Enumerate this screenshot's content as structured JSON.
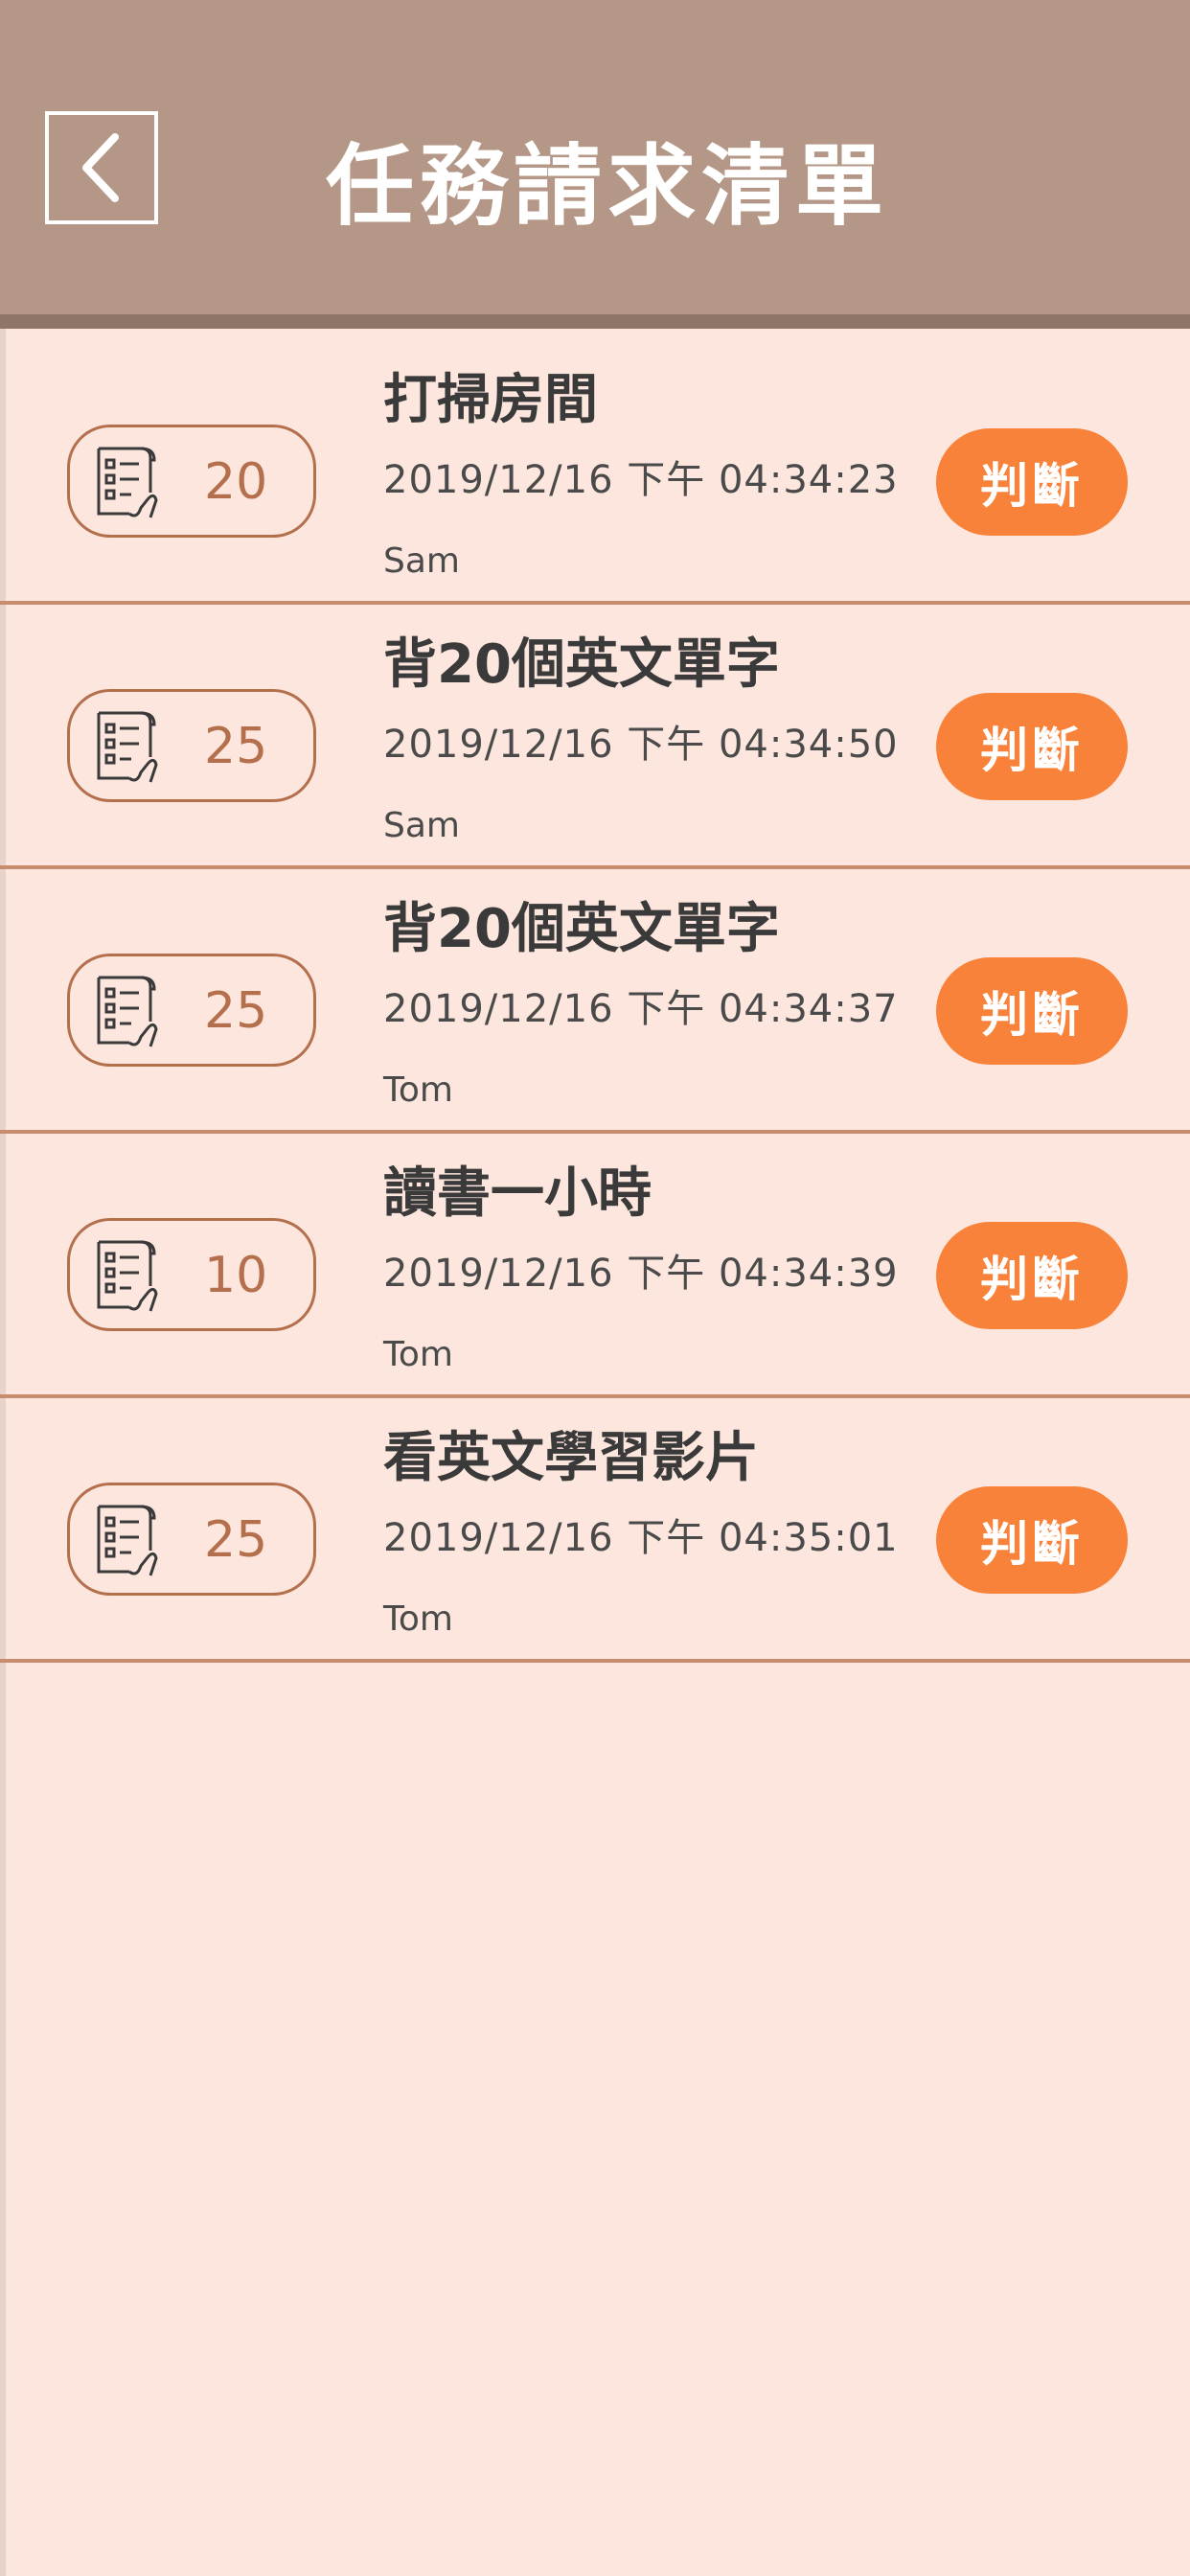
{
  "header": {
    "title": "任務請求清單",
    "back_icon": "chevron-left-icon"
  },
  "colors": {
    "header_bg": "#b49787",
    "page_bg": "#fde6dd",
    "accent": "#f8823a",
    "badge_border": "#b4704d"
  },
  "tasks": [
    {
      "points": "20",
      "title": "打掃房間",
      "time": "2019/12/16 下午 04:34:23",
      "user": "Sam",
      "button_label": "判斷"
    },
    {
      "points": "25",
      "title": "背20個英文單字",
      "time": "2019/12/16 下午 04:34:50",
      "user": "Sam",
      "button_label": "判斷"
    },
    {
      "points": "25",
      "title": "背20個英文單字",
      "time": "2019/12/16 下午 04:34:37",
      "user": "Tom",
      "button_label": "判斷"
    },
    {
      "points": "10",
      "title": "讀書一小時",
      "time": "2019/12/16 下午 04:34:39",
      "user": "Tom",
      "button_label": "判斷"
    },
    {
      "points": "25",
      "title": "看英文學習影片",
      "time": "2019/12/16 下午 04:35:01",
      "user": "Tom",
      "button_label": "判斷"
    }
  ]
}
